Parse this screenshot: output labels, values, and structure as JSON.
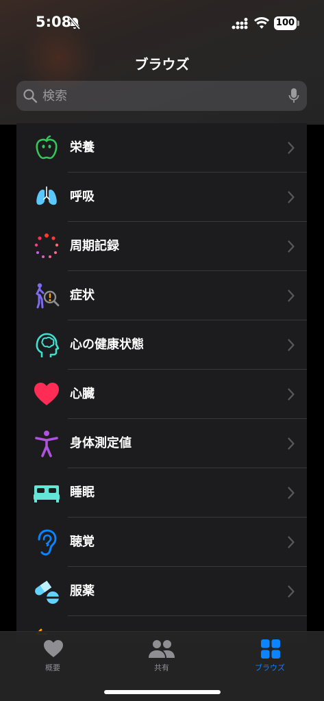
{
  "status_bar": {
    "time": "5:08",
    "battery": "100"
  },
  "nav": {
    "title": "ブラウズ"
  },
  "search": {
    "placeholder": "検索",
    "icon": "search-icon",
    "mic_icon": "microphone-icon"
  },
  "categories": [
    {
      "label": "栄養",
      "icon": "apple-nutrition-icon",
      "color": "#34c759"
    },
    {
      "label": "呼吸",
      "icon": "lungs-icon",
      "color": "#5ac8fa"
    },
    {
      "label": "周期記録",
      "icon": "cycle-tracking-icon",
      "color": "#ff2d55"
    },
    {
      "label": "症状",
      "icon": "symptoms-icon",
      "color": "#5e5ce6"
    },
    {
      "label": "心の健康状態",
      "icon": "mental-wellbeing-icon",
      "color": "#40e0d0"
    },
    {
      "label": "心臓",
      "icon": "heart-icon",
      "color": "#ff2d55"
    },
    {
      "label": "身体測定値",
      "icon": "body-measurements-icon",
      "color": "#af52de"
    },
    {
      "label": "睡眠",
      "icon": "bed-sleep-icon",
      "color": "#63e6d6"
    },
    {
      "label": "聴覚",
      "icon": "ear-hearing-icon",
      "color": "#0a84ff"
    },
    {
      "label": "服薬",
      "icon": "pills-medications-icon",
      "color": "#64d2ff"
    }
  ],
  "tabs": [
    {
      "label": "概要",
      "icon": "heart-summary-icon",
      "active": false
    },
    {
      "label": "共有",
      "icon": "people-sharing-icon",
      "active": false
    },
    {
      "label": "ブラウズ",
      "icon": "grid-browse-icon",
      "active": true
    }
  ],
  "colors": {
    "accent": "#0a84ff",
    "inactive": "#8e8e93"
  }
}
